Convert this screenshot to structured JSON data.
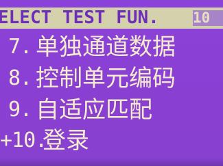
{
  "screen": {
    "title": "ELECT TEST FUN.",
    "title_counter": "10",
    "colors": {
      "background": "#8a3fd6",
      "title_bar": "#d6d1ad",
      "text": "#f4eccb"
    }
  },
  "menu": {
    "items": [
      {
        "number": "7.",
        "label": "单独通道数据"
      },
      {
        "number": "8.",
        "label": "控制单元编码"
      },
      {
        "number": "9.",
        "label": "自适应匹配"
      },
      {
        "number": "+10.",
        "label": "登录",
        "selected": true
      }
    ]
  }
}
